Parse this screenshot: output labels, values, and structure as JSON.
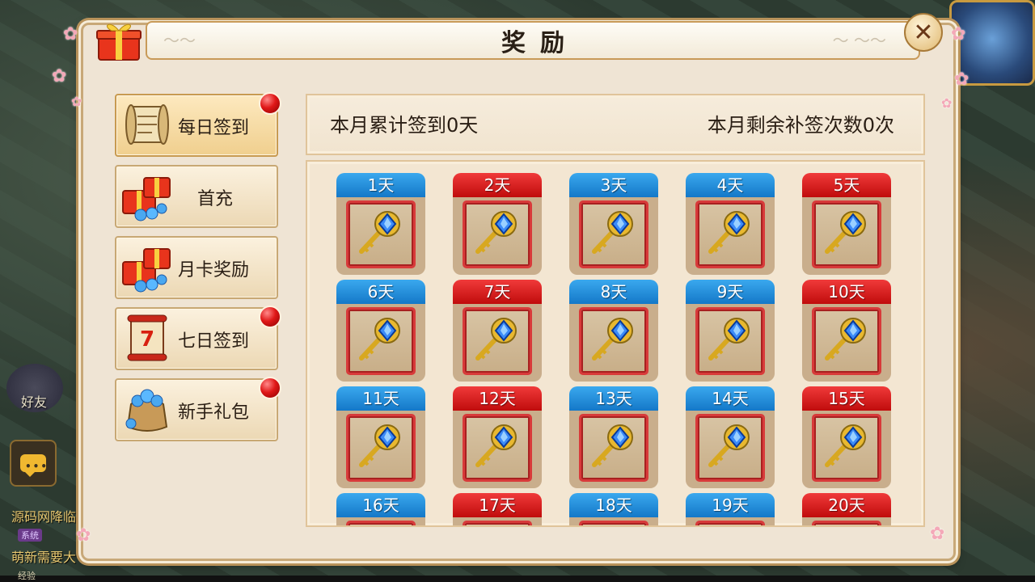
{
  "window": {
    "title": "奖励",
    "close_icon": "close-icon"
  },
  "background": {
    "friend_label": "好友",
    "chat_lines": [
      {
        "tag": "",
        "text": "源码网降临"
      },
      {
        "tag": "系统",
        "text": "萌新需要大"
      }
    ],
    "xp_label": "经验"
  },
  "menu": [
    {
      "label": "每日签到",
      "icon": "scroll-icon",
      "badge": true,
      "active": true
    },
    {
      "label": "首充",
      "icon": "gift-gems-icon",
      "badge": false,
      "active": false
    },
    {
      "label": "月卡奖励",
      "icon": "gift-gems-icon",
      "badge": false,
      "active": false
    },
    {
      "label": "七日签到",
      "icon": "red-scroll-icon",
      "badge": true,
      "active": false
    },
    {
      "label": "新手礼包",
      "icon": "gem-bag-icon",
      "badge": true,
      "active": false
    }
  ],
  "summary": {
    "signed_text": "本月累计签到0天",
    "remaining_text": "本月剩余补签次数0次"
  },
  "days": [
    {
      "label": "1天",
      "color": "blue"
    },
    {
      "label": "2天",
      "color": "red"
    },
    {
      "label": "3天",
      "color": "blue"
    },
    {
      "label": "4天",
      "color": "blue"
    },
    {
      "label": "5天",
      "color": "red"
    },
    {
      "label": "6天",
      "color": "blue"
    },
    {
      "label": "7天",
      "color": "red"
    },
    {
      "label": "8天",
      "color": "blue"
    },
    {
      "label": "9天",
      "color": "blue"
    },
    {
      "label": "10天",
      "color": "red"
    },
    {
      "label": "11天",
      "color": "blue"
    },
    {
      "label": "12天",
      "color": "red"
    },
    {
      "label": "13天",
      "color": "blue"
    },
    {
      "label": "14天",
      "color": "blue"
    },
    {
      "label": "15天",
      "color": "red"
    },
    {
      "label": "16天",
      "color": "blue"
    },
    {
      "label": "17天",
      "color": "red"
    },
    {
      "label": "18天",
      "color": "blue"
    },
    {
      "label": "19天",
      "color": "blue"
    },
    {
      "label": "20天",
      "color": "red"
    }
  ],
  "reward_icon": "golden-key-icon",
  "colors": {
    "tab_blue": "#1e8ed8",
    "tab_red": "#d81818",
    "badge_red": "#e01818",
    "frame_red": "#d83a3a"
  }
}
